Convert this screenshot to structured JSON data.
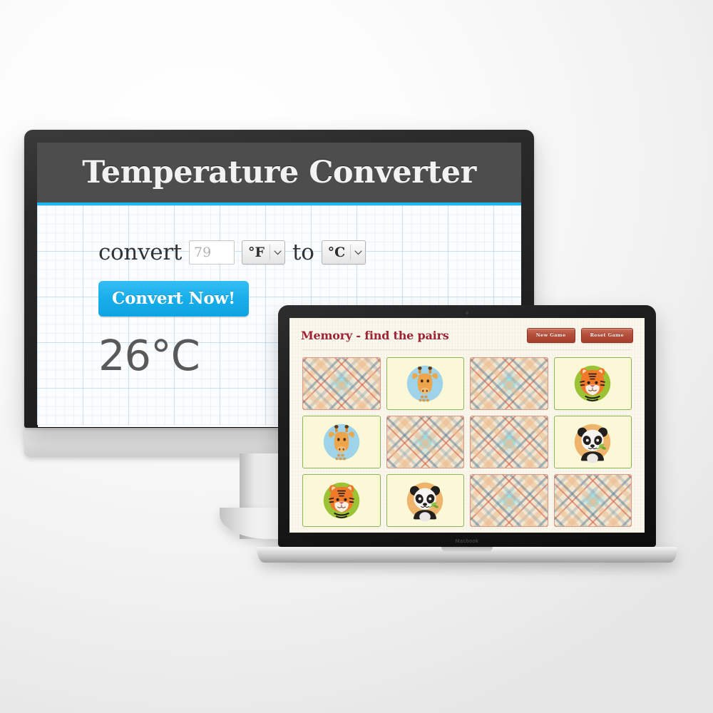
{
  "scene": {
    "description": "Two devices showing two web apps",
    "background_gradient": [
      "#ffffff",
      "#e6e6e6"
    ]
  },
  "desktop": {
    "device_name": "desktop-monitor",
    "site": {
      "header": {
        "title": "Temperature Converter",
        "bg": "#4d4d4d",
        "accent": "#19b9ef"
      },
      "form": {
        "label_convert": "convert",
        "amount_value": "79",
        "amount_placeholder": "79",
        "from_unit": "°F",
        "label_to": "to",
        "to_unit": "°C",
        "unit_options": [
          "°F",
          "°C"
        ],
        "submit_label": "Convert Now!",
        "submit_color": "#16aeea"
      },
      "result": "26°C"
    }
  },
  "laptop": {
    "device_name": "macbook",
    "brand_label": "Macbook",
    "site": {
      "title": "Memory - find the pairs",
      "title_color": "#9d2335",
      "buttons": [
        {
          "name": "new-game",
          "label": "New Game"
        },
        {
          "name": "reset-game",
          "label": "Reset Game"
        }
      ],
      "board": {
        "columns": 4,
        "rows": 3,
        "card_back_name": "plaid-card-back",
        "cards": [
          {
            "state": "back",
            "animal": ""
          },
          {
            "state": "faceup",
            "animal": "giraffe"
          },
          {
            "state": "back",
            "animal": ""
          },
          {
            "state": "faceup",
            "animal": "tiger"
          },
          {
            "state": "faceup",
            "animal": "giraffe"
          },
          {
            "state": "back",
            "animal": ""
          },
          {
            "state": "back",
            "animal": ""
          },
          {
            "state": "faceup",
            "animal": "panda"
          },
          {
            "state": "faceup",
            "animal": "tiger"
          },
          {
            "state": "faceup",
            "animal": "panda"
          },
          {
            "state": "back",
            "animal": ""
          },
          {
            "state": "back",
            "animal": ""
          }
        ],
        "animal_colors": {
          "giraffe": "#9ed3ea",
          "tiger": "#9cc235",
          "panda": "#eeb46c"
        }
      }
    }
  }
}
